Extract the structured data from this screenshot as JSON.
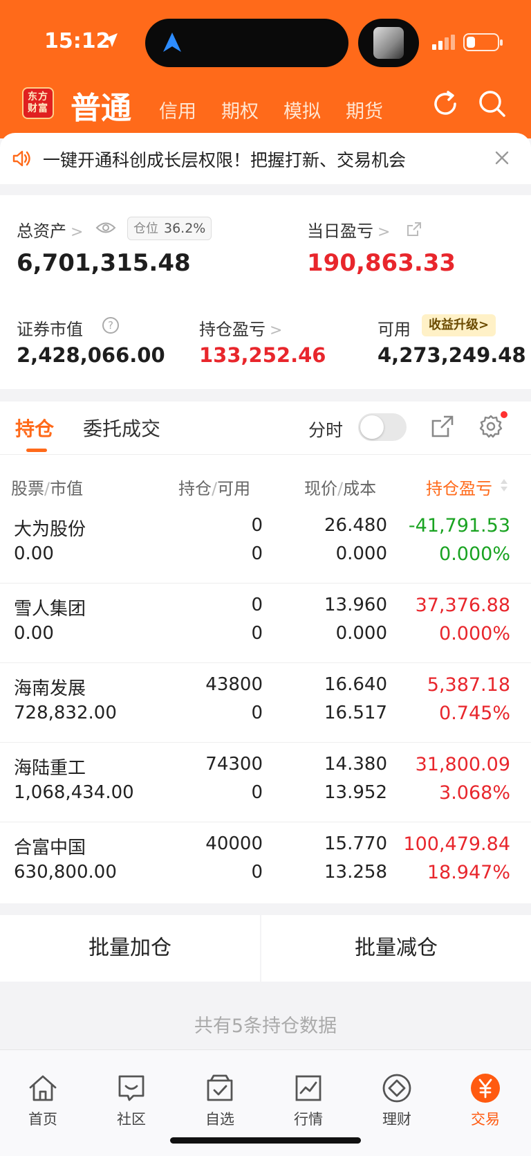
{
  "status": {
    "time": "15:12"
  },
  "header": {
    "logo_text_1": "东方",
    "logo_text_2": "财富",
    "tabs": [
      {
        "label": "普通",
        "active": true
      },
      {
        "label": "信用"
      },
      {
        "label": "期权"
      },
      {
        "label": "模拟"
      },
      {
        "label": "期货"
      }
    ]
  },
  "notice": {
    "text": "一键开通科创成长层权限！把握打新、交易机会"
  },
  "summary": {
    "total_assets_label": "总资产",
    "position_ratio_label": "仓位",
    "position_ratio_value": "36.2%",
    "total_assets_value": "6,701,315.48",
    "daily_pl_label": "当日盈亏",
    "daily_pl_value": "190,863.33",
    "securities_value_label": "证券市值",
    "securities_value": "2,428,066.00",
    "holding_pl_label": "持仓盈亏",
    "holding_pl_value": "133,252.46",
    "available_label": "可用",
    "upgrade_label": "收益升级>",
    "available_value": "4,273,249.48"
  },
  "list": {
    "tab_holdings": "持仓",
    "tab_orders": "委托成交",
    "fenshi_label": "分时",
    "columns": {
      "stock": "股票",
      "market_value": "市值",
      "position": "持仓",
      "available": "可用",
      "price": "现价",
      "cost": "成本",
      "pl": "持仓盈亏"
    },
    "rows": [
      {
        "name": "大为股份",
        "market_value": "0.00",
        "position": "0",
        "available": "0",
        "price": "26.480",
        "cost": "0.000",
        "pl": "-41,791.53",
        "pl_pct": "0.000%"
      },
      {
        "name": "雪人集团",
        "market_value": "0.00",
        "position": "0",
        "available": "0",
        "price": "13.960",
        "cost": "0.000",
        "pl": "37,376.88",
        "pl_pct": "0.000%"
      },
      {
        "name": "海南发展",
        "market_value": "728,832.00",
        "position": "43800",
        "available": "0",
        "price": "16.640",
        "cost": "16.517",
        "pl": "5,387.18",
        "pl_pct": "0.745%"
      },
      {
        "name": "海陆重工",
        "market_value": "1,068,434.00",
        "position": "74300",
        "available": "0",
        "price": "14.380",
        "cost": "13.952",
        "pl": "31,800.09",
        "pl_pct": "3.068%"
      },
      {
        "name": "合富中国",
        "market_value": "630,800.00",
        "position": "40000",
        "available": "0",
        "price": "15.770",
        "cost": "13.258",
        "pl": "100,479.84",
        "pl_pct": "18.947%"
      }
    ]
  },
  "actions": {
    "batch_add": "批量加仓",
    "batch_reduce": "批量减仓"
  },
  "total_note": "共有5条持仓数据",
  "tabbar": [
    {
      "label": "首页",
      "icon": "home-icon"
    },
    {
      "label": "社区",
      "icon": "community-icon"
    },
    {
      "label": "自选",
      "icon": "watchlist-icon"
    },
    {
      "label": "行情",
      "icon": "market-icon"
    },
    {
      "label": "理财",
      "icon": "wealth-icon"
    },
    {
      "label": "交易",
      "icon": "trade-icon",
      "active": true
    }
  ],
  "colors": {
    "brand": "#ff6a1a",
    "up": "#e8262c",
    "down": "#19a321"
  }
}
